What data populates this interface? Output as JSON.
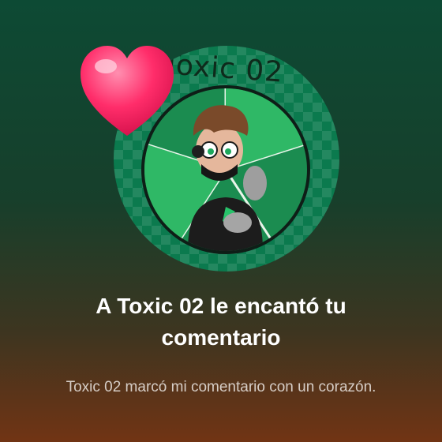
{
  "notification": {
    "avatar_name": "Toxic 02",
    "title": "A Toxic 02 le encantó tu comentario",
    "subtitle": "Toxic 02 marcó mi comentario con un corazón."
  },
  "colors": {
    "avatar_bg": "#0b7a4e",
    "heart": "#ff2d6a",
    "title": "#ffffff",
    "subtitle": "#d6cdc6"
  },
  "icons": {
    "heart": "heart-icon"
  }
}
